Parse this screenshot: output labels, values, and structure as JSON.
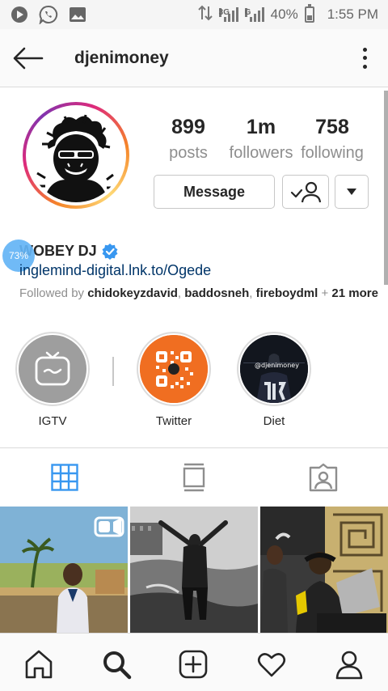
{
  "status_bar": {
    "net_3g": "3G",
    "net_g": "G",
    "battery": "40%",
    "battery_level": 0.4,
    "time": "1:55 PM",
    "icons": [
      "play-icon",
      "whatsapp-icon",
      "image-icon",
      "data-transfer-icon"
    ]
  },
  "header": {
    "username": "djenimoney",
    "back_icon": "back-arrow-icon",
    "more_icon": "more-vertical-icon"
  },
  "profile": {
    "stats": [
      {
        "value": "899",
        "label": "posts"
      },
      {
        "value": "1m",
        "label": "followers"
      },
      {
        "value": "758",
        "label": "following"
      }
    ],
    "message_label": "Message",
    "display_name": "WOBEY DJ",
    "overlay_badge": "73%",
    "bio_link": "inglemind-digital.lnk.to/Ogede",
    "followed_by_prefix": "Followed by ",
    "followed_by_users": [
      "chidokeyzdavid",
      "baddosneh",
      "fireboydml"
    ],
    "followed_by_more": "21 more",
    "verified_color": "#3897f0"
  },
  "highlights": [
    {
      "label": "IGTV"
    },
    {
      "label": "Twitter"
    },
    {
      "label": "Diet",
      "watermark": "@djenimoney"
    }
  ],
  "tabs": [
    "grid-icon",
    "feed-icon",
    "tagged-icon"
  ],
  "bottom_nav": [
    "home-icon",
    "search-icon",
    "add-post-icon",
    "activity-icon",
    "profile-icon"
  ],
  "colors": {
    "accent": "#3897f0",
    "link": "#003569",
    "muted": "#8e8e8e",
    "text": "#262626"
  }
}
